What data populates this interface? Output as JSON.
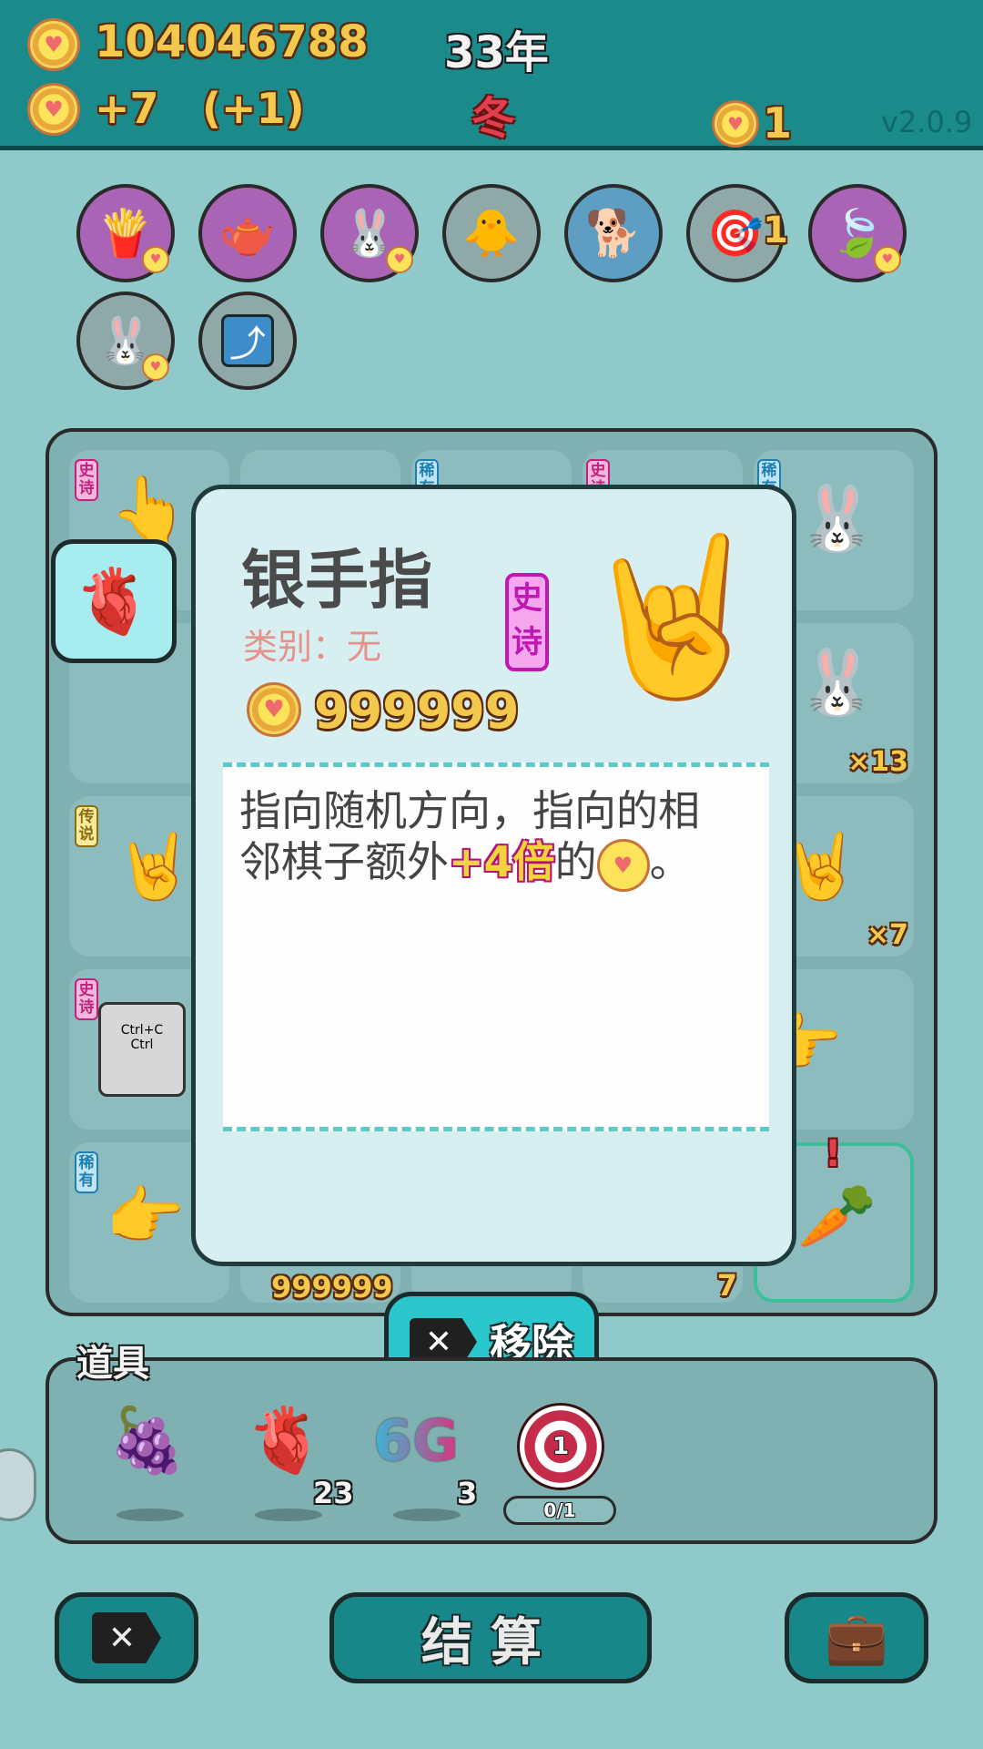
{
  "header": {
    "coins": "104046788",
    "income": "+7",
    "income_bonus": "(+1)",
    "year": "33年",
    "season": "冬",
    "extra_coins": "1",
    "version": "v2.0.9"
  },
  "buffs": [
    {
      "name": "fries",
      "icon": "🍟"
    },
    {
      "name": "gravy-boat",
      "icon": "🫖"
    },
    {
      "name": "rabbit",
      "icon": "🐰"
    },
    {
      "name": "chick",
      "icon": "🐥"
    },
    {
      "name": "dog",
      "icon": "🐕"
    },
    {
      "name": "target-coin",
      "icon": "🎯",
      "count": "1"
    },
    {
      "name": "leaf",
      "icon": "🍃"
    },
    {
      "name": "rabbit-2",
      "icon": "🐰"
    },
    {
      "name": "arrow-card",
      "icon": "⤴"
    }
  ],
  "board": {
    "rarity_labels": {
      "epic": "史诗",
      "rare": "稀有",
      "legend": "传说"
    },
    "counts": {
      "right_row2": "×13",
      "right_row3": "×7",
      "bottom_price": "999999",
      "bottom_count": "7"
    },
    "ctrl_card": "Ctrl+C\nCtrl"
  },
  "modal": {
    "title": "银手指",
    "category": "类别：无",
    "badge": "史诗",
    "price": "999999",
    "desc_line1": "指向随机方向，指向的相",
    "desc_prefix": "邻棋子额外",
    "desc_highlight": "+4倍",
    "desc_mid": "的",
    "desc_suffix": "。"
  },
  "remove_button": {
    "label": "移除"
  },
  "items": {
    "title": "道具",
    "list": [
      {
        "name": "bayberry",
        "icon": "🍇",
        "count": ""
      },
      {
        "name": "liver",
        "icon": "🫀",
        "count": "23"
      },
      {
        "name": "6g",
        "text": "6G",
        "count": "3"
      },
      {
        "name": "target",
        "text": "1",
        "progress": "0/1"
      }
    ]
  },
  "bottom": {
    "settle_label": "结算"
  },
  "colors": {
    "header_bg": "#1a8a8a",
    "accent": "#2cc7cc",
    "epic": "#c018b2",
    "gold": "#f2c94c"
  }
}
